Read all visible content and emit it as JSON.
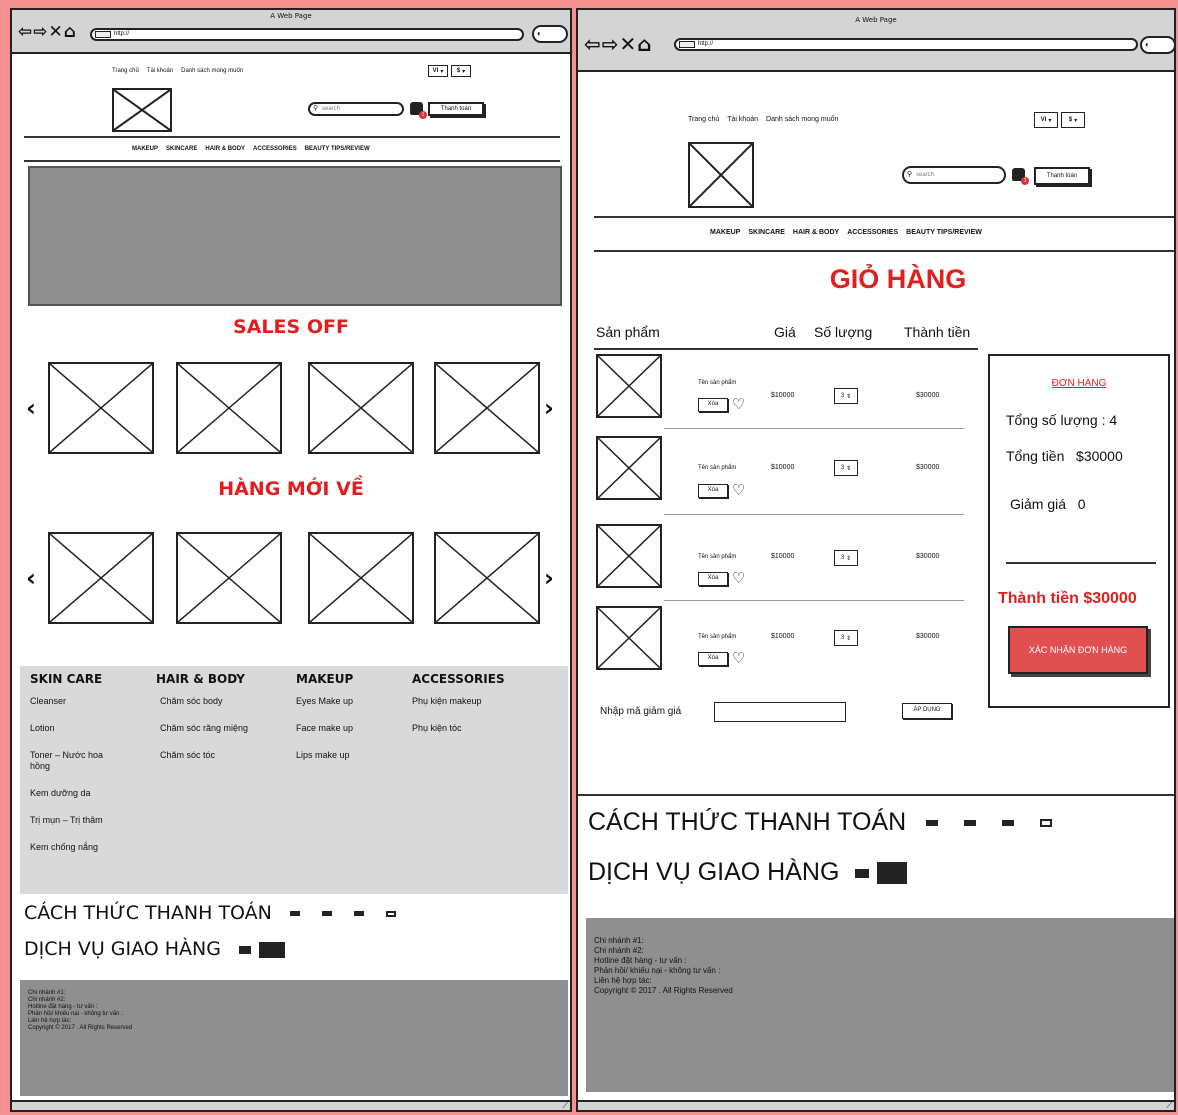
{
  "browser": {
    "title": "A Web Page",
    "url": "http://"
  },
  "header": {
    "links": [
      "Trang chủ",
      "Tài khoản",
      "Danh sách mong muốn"
    ],
    "lang": "VI",
    "currency": "$",
    "search_placeholder": "search",
    "cart_count": "1",
    "checkout_label": "Thanh toán"
  },
  "nav": [
    "MAKEUP",
    "SKINCARE",
    "HAIR & BODY",
    "ACCESSORIES",
    "BEAUTY TIPS/REVIEW"
  ],
  "home": {
    "sales_title": "SALES OFF",
    "new_title": "HÀNG MỚI VỀ"
  },
  "footer_cats": [
    {
      "title": "SKIN CARE",
      "items": [
        "Cleanser",
        "Lotion",
        "Toner – Nước hoa hồng",
        "Kem dưỡng da",
        "Trị mụn – Trị thâm",
        "Kem chống nắng"
      ]
    },
    {
      "title": "HAIR & BODY",
      "items": [
        "Chăm sóc body",
        "Chăm sóc răng miệng",
        "Chăm sóc tóc"
      ]
    },
    {
      "title": "MAKEUP",
      "items": [
        "Eyes Make up",
        "Face make up",
        "Lips make up"
      ]
    },
    {
      "title": "ACCESSORIES",
      "items": [
        "Phụ kiện makeup",
        "Phụ kiện tóc"
      ]
    }
  ],
  "payment_title": "CÁCH THỨC THANH TOÁN",
  "shipping_title": "DỊCH VỤ GIAO HÀNG",
  "footer_info": [
    "Chi nhánh #1:",
    "Chi nhánh #2:",
    "Hotline đặt hàng - tư vấn :",
    "Phản hồi/ khiếu nại - không tư vấn :",
    "Liên hệ hợp tác:",
    "Copyright © 2017 . All Rights Reserved"
  ],
  "cart": {
    "title": "GIỎ HÀNG",
    "headers": {
      "product": "Sản phẩm",
      "price": "Giá",
      "quantity": "Số lượng",
      "total": "Thành tiền"
    },
    "items": [
      {
        "name": "Tên sản phẩm",
        "delete": "Xóa",
        "price": "$10000",
        "qty": "3",
        "total": "$30000"
      },
      {
        "name": "Tên sản phẩm",
        "delete": "Xóa",
        "price": "$10000",
        "qty": "3",
        "total": "$30000"
      },
      {
        "name": "Tên sản phẩm",
        "delete": "Xóa",
        "price": "$10000",
        "qty": "3",
        "total": "$30000"
      },
      {
        "name": "Tên sản phẩm",
        "delete": "Xóa",
        "price": "$10000",
        "qty": "3",
        "total": "$30000"
      }
    ],
    "coupon_label": "Nhập mã giảm giá",
    "apply_label": "ÁP DỤNG",
    "order": {
      "title": "ĐƠN HÀNG",
      "total_qty": "Tổng số lượng : 4",
      "total_money": "Tổng tiền   $30000",
      "discount": "Giảm giá   0",
      "grand_total": "Thành tiền $30000",
      "confirm": "XÁC NHẬN ĐƠN HÀNG"
    }
  }
}
